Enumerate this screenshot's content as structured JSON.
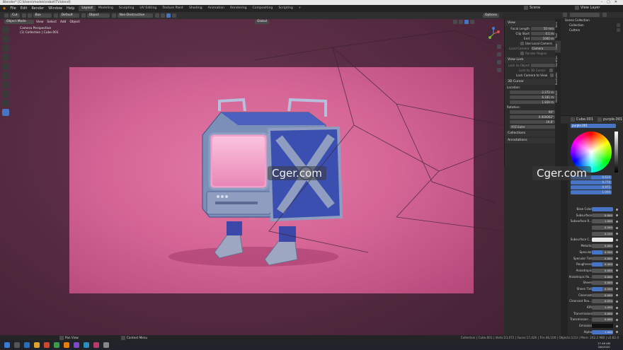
{
  "window": {
    "title": "Blender* [C:\\Users\\models\\robot\\TV.blend]"
  },
  "topmenu": {
    "items": [
      "File",
      "Edit",
      "Render",
      "Window",
      "Help"
    ],
    "workspaces": [
      "Layout",
      "Modeling",
      "Sculpting",
      "UV Editing",
      "Texture Paint",
      "Shading",
      "Animation",
      "Rendering",
      "Compositing",
      "Scripting"
    ],
    "active_workspace": "Layout",
    "scene": "Scene",
    "view_layer": "View Layer"
  },
  "toolheader": {
    "cut": "Cut",
    "box": "Box",
    "default": "Default",
    "object": "Object",
    "nondestructive": "Non-Destructive",
    "options": "Options"
  },
  "viewport": {
    "mode": "Object Mode",
    "menus": [
      "View",
      "Select",
      "Add",
      "Object"
    ],
    "transform": "Global",
    "camera_label": "Camera Perspective",
    "collection_label": "(1) Collection | Cube.001",
    "watermark": "Cger.com"
  },
  "npanel": {
    "tabs": [
      "Item",
      "Tool",
      "View",
      "HardOps",
      "BoxCutter",
      "MACHIN3"
    ],
    "view_header": "View",
    "focal_length_label": "Focal Length",
    "focal_length": "50 mm",
    "clip_start_label": "Clip Start",
    "clip_start": "0.1 m",
    "end_label": "End",
    "end": "1000 m",
    "use_local_camera": "Use Local Camera",
    "local_camera_label": "Local Camera",
    "local_camera": "Camera",
    "render_region": "Render Region",
    "view_lock_header": "View Lock",
    "lock_to_object": "Lock to Object",
    "lock_to_3d_cursor": "Lock to 3D Cursor",
    "lock_camera_to_view": "Lock Camera to View",
    "cursor_header": "3D Cursor",
    "location_label": "Location:",
    "loc_x": "2.272 m",
    "loc_y": "6.181 m",
    "loc_z": "1.839 m",
    "rotation_label": "Rotation:",
    "rot_x": "90°",
    "rot_y": "0.000002°",
    "rot_z": "19.8°",
    "rotation_mode": "XYZ Euler",
    "collections_header": "Collections",
    "annotations_header": "Annotations"
  },
  "outliner": {
    "title": "Scene Collection",
    "items": [
      "Collection",
      "Cutters"
    ]
  },
  "properties": {
    "object_name": "Cube.001",
    "material_name": "purple.001",
    "color_values": [
      "0.614",
      "0.770",
      "0.971",
      "1.000"
    ],
    "rows": [
      {
        "label": "Base Color",
        "value": "",
        "kind": "color"
      },
      {
        "label": "Subsurface",
        "value": "0.000"
      },
      {
        "label": "Subsurface R...",
        "value": "1.000"
      },
      {
        "label": "",
        "value": "0.200"
      },
      {
        "label": "",
        "value": "0.100"
      },
      {
        "label": "Subsurface C...",
        "value": "",
        "kind": "white"
      },
      {
        "label": "Metallic",
        "value": "0.000"
      },
      {
        "label": "Specular",
        "value": "0.500",
        "kind": "partial"
      },
      {
        "label": "Specular Tint",
        "value": "0.000"
      },
      {
        "label": "Roughness",
        "value": "0.400",
        "kind": "partial"
      },
      {
        "label": "Anisotropic",
        "value": "0.000"
      },
      {
        "label": "Anisotropic Ro...",
        "value": "0.000"
      },
      {
        "label": "Sheen",
        "value": "0.000"
      },
      {
        "label": "Sheen Tint",
        "value": "0.500",
        "kind": "partial"
      },
      {
        "label": "Clearcoat",
        "value": "0.000"
      },
      {
        "label": "Clearcoat Rou...",
        "value": "0.030"
      },
      {
        "label": "IOR",
        "value": "1.450"
      },
      {
        "label": "Transmission",
        "value": "0.000"
      },
      {
        "label": "Transmission ...",
        "value": "0.000"
      },
      {
        "label": "Emission",
        "value": "",
        "kind": "black"
      },
      {
        "label": "Alpha",
        "value": "1.000",
        "kind": "full"
      },
      {
        "label": "Normal",
        "value": "Default"
      }
    ]
  },
  "statusbar": {
    "pan_view": "Pan View",
    "context_menu": "Context Menu",
    "stats": "Collection | Cube.001 | Verts:23,072 | Faces:17,426 | Tris:46,100 | Objects:1/13 | Mem: 242.2 MiB | v2.82.4"
  },
  "taskbar": {
    "time": "17:46 AM",
    "date": "2/6/2020"
  },
  "colors": {
    "accent": "#4774c4",
    "viewport_bg": "#5a2d44",
    "camera_bg": "#d56696",
    "robot_blue": "#3a4fb0"
  }
}
